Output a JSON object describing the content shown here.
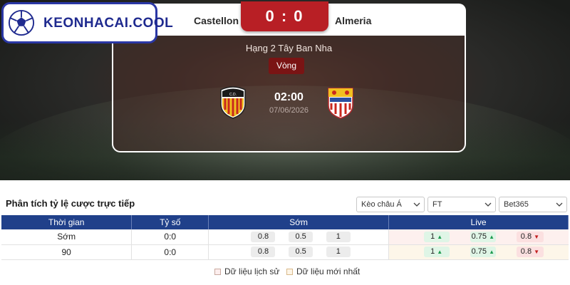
{
  "brand": {
    "logo_text": "KEONHACAI.COOL"
  },
  "match": {
    "home_team": "Castellon",
    "away_team": "Almeria",
    "score": "0 : 0",
    "league": "Hạng 2 Tây Ban Nha",
    "round_label": "Vòng",
    "kickoff_time": "02:00",
    "kickoff_date": "07/06/2026"
  },
  "odds_section": {
    "title": "Phân tích tỷ lệ cược trực tiếp",
    "filters": [
      {
        "value": "Kèo châu Á",
        "icon": "chevron-down-icon"
      },
      {
        "value": "FT",
        "icon": "chevron-down-icon"
      },
      {
        "value": "Bet365",
        "icon": "chevron-down-icon"
      }
    ],
    "columns": [
      "Thời gian",
      "Tỷ số",
      "Sớm",
      "Live"
    ],
    "rows": [
      {
        "time": "Sớm",
        "score": "0:0",
        "early": [
          "0.8",
          "0.5",
          "1"
        ],
        "live": [
          "1",
          "0.75",
          "0.8"
        ]
      },
      {
        "time": "90",
        "score": "0:0",
        "early": [
          "0.8",
          "0.5",
          "1"
        ],
        "live": [
          "1",
          "0.75",
          "0.8"
        ]
      }
    ],
    "legend": [
      "Dữ liệu lịch sử",
      "Dữ liệu mới nhất"
    ]
  },
  "colors": {
    "brand_blue": "#20408a",
    "score_red": "#b81f25",
    "odds_up": "#1e9b4f",
    "odds_down": "#c32020"
  }
}
